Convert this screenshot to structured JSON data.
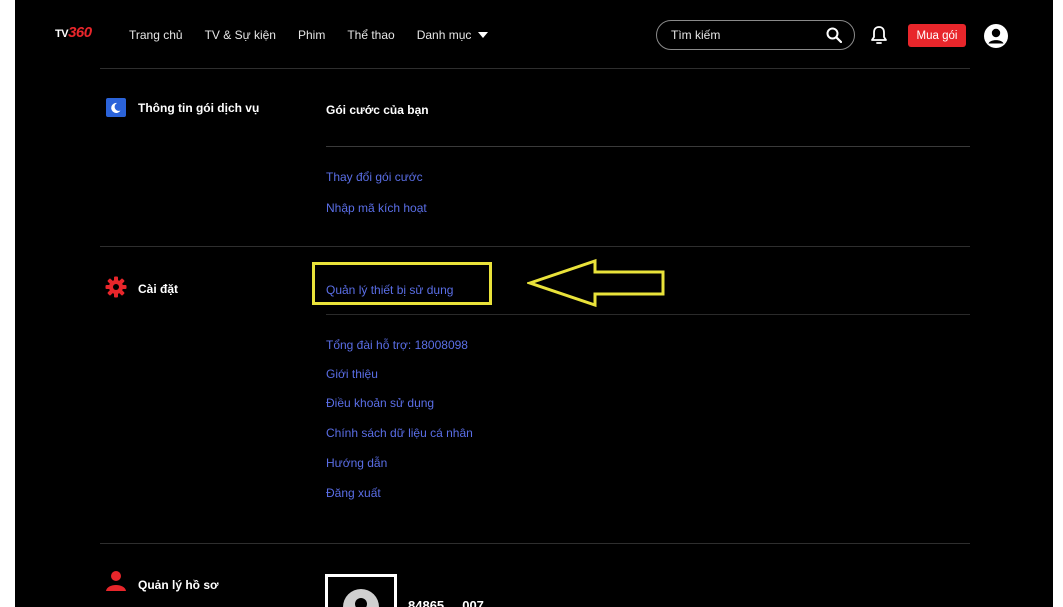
{
  "header": {
    "logo_prefix": "TV",
    "logo_suffix": "360",
    "nav": [
      "Trang chủ",
      "TV & Sự kiện",
      "Phim",
      "Thể thao",
      "Danh mục"
    ],
    "search_placeholder": "Tìm kiếm",
    "buy_label": "Mua gói"
  },
  "sections": {
    "service": {
      "title": "Thông tin gói dịch vụ",
      "subtitle": "Gói cước của bạn",
      "links": [
        "Thay đổi gói cước",
        "Nhập mã kích hoạt"
      ]
    },
    "settings": {
      "title": "Cài đặt",
      "links": [
        "Quản lý thiết bị sử dụng",
        "Tổng đài hỗ trợ: 18008098",
        "Giới thiệu",
        "Điều khoản sử dụng",
        "Chính sách dữ liệu cá nhân",
        "Hướng dẫn",
        "Đăng xuất"
      ]
    },
    "profile": {
      "title": "Quản lý hồ sơ",
      "name": "84865 ... 007"
    }
  },
  "colors": {
    "background": "#000000",
    "accent_red": "#e8262b",
    "link_blue": "#5a6ee6",
    "highlight_yellow": "#e9e23a"
  },
  "icons": {
    "service": "moon-calendar-icon",
    "settings": "gear-icon",
    "profile": "person-icon",
    "search": "search-icon",
    "notifications": "bell-icon",
    "account": "user-circle-icon"
  }
}
